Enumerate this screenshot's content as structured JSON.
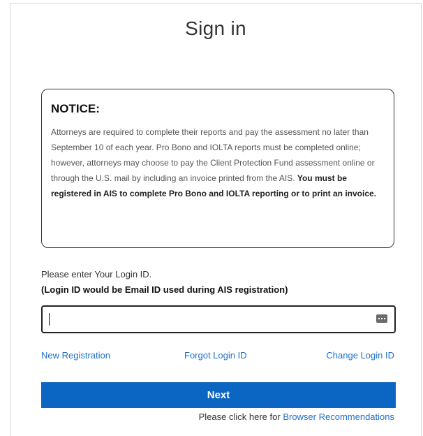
{
  "page": {
    "title": "Sign in"
  },
  "notice": {
    "heading": "NOTICE:",
    "body_plain": "Attorneys are required to complete their reports and pay the assessment no later than September 10 of each year. Pro Bono and IOLTA reports must be completed online; however, attorneys may choose to pay the Client Protection Fund assessment online or through the U.S. mail by including an invoice printed from the AIS. ",
    "body_bold": "You must be registered in AIS to complete Pro Bono and IOLTA reporting or to print an invoice."
  },
  "login": {
    "label": "Please enter Your Login ID.",
    "hint": "(Login ID would be Email ID used during AIS registration)",
    "value": "",
    "icon": "password-manager-icon"
  },
  "links": {
    "new_registration": "New Registration",
    "forgot_login": "Forgot Login ID",
    "change_login": "Change Login ID"
  },
  "actions": {
    "next_label": "Next"
  },
  "footer": {
    "prefix": "Please click here for ",
    "link": "Browser Recommendations"
  },
  "colors": {
    "accent": "#0b66c3",
    "link": "#1f6fc9"
  }
}
